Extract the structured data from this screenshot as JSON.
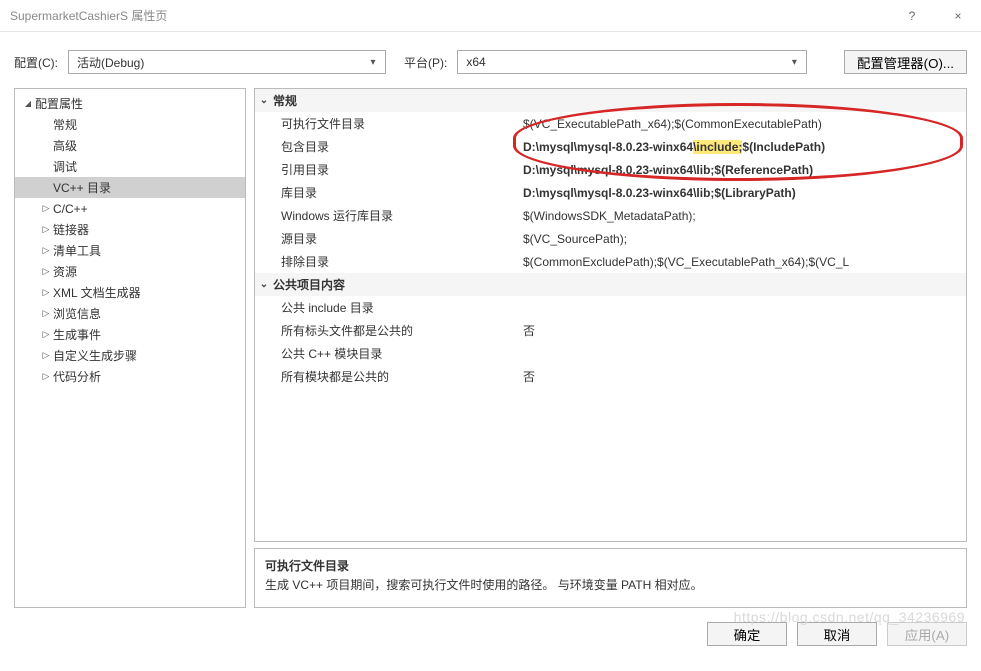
{
  "window": {
    "title": "SupermarketCashierS 属性页",
    "help_icon": "?",
    "close_icon": "×"
  },
  "toolbar": {
    "config_label": "配置(C):",
    "config_value": "活动(Debug)",
    "platform_label": "平台(P):",
    "platform_value": "x64",
    "manager_button": "配置管理器(O)..."
  },
  "tree": [
    {
      "label": "配置属性",
      "depth": 0,
      "expander": "expanded"
    },
    {
      "label": "常规",
      "depth": 1,
      "expander": ""
    },
    {
      "label": "高级",
      "depth": 1,
      "expander": ""
    },
    {
      "label": "调试",
      "depth": 1,
      "expander": ""
    },
    {
      "label": "VC++ 目录",
      "depth": 1,
      "expander": "",
      "selected": true
    },
    {
      "label": "C/C++",
      "depth": 1,
      "expander": "collapsed"
    },
    {
      "label": "链接器",
      "depth": 1,
      "expander": "collapsed"
    },
    {
      "label": "清单工具",
      "depth": 1,
      "expander": "collapsed"
    },
    {
      "label": "资源",
      "depth": 1,
      "expander": "collapsed"
    },
    {
      "label": "XML 文档生成器",
      "depth": 1,
      "expander": "collapsed"
    },
    {
      "label": "浏览信息",
      "depth": 1,
      "expander": "collapsed"
    },
    {
      "label": "生成事件",
      "depth": 1,
      "expander": "collapsed"
    },
    {
      "label": "自定义生成步骤",
      "depth": 1,
      "expander": "collapsed"
    },
    {
      "label": "代码分析",
      "depth": 1,
      "expander": "collapsed"
    }
  ],
  "groups": [
    {
      "title": "常规",
      "rows": [
        {
          "name": "可执行文件目录",
          "value": "$(VC_ExecutablePath_x64);$(CommonExecutablePath)"
        },
        {
          "name": "包含目录",
          "value_prefix": "D:\\mysql\\mysql-8.0.23-winx64",
          "value_hl": "\\include;",
          "value_suffix": "$(IncludePath)",
          "bold": true
        },
        {
          "name": "引用目录",
          "value": "D:\\mysql\\mysql-8.0.23-winx64\\lib;$(ReferencePath)",
          "bold": true
        },
        {
          "name": "库目录",
          "value": "D:\\mysql\\mysql-8.0.23-winx64\\lib;$(LibraryPath)",
          "bold": true
        },
        {
          "name": "Windows 运行库目录",
          "value": "$(WindowsSDK_MetadataPath);"
        },
        {
          "name": "源目录",
          "value": "$(VC_SourcePath);"
        },
        {
          "name": "排除目录",
          "value": "$(CommonExcludePath);$(VC_ExecutablePath_x64);$(VC_L"
        }
      ]
    },
    {
      "title": "公共项目内容",
      "rows": [
        {
          "name": "公共 include 目录",
          "value": ""
        },
        {
          "name": "所有标头文件都是公共的",
          "value": "否"
        },
        {
          "name": "公共 C++ 模块目录",
          "value": ""
        },
        {
          "name": "所有模块都是公共的",
          "value": "否"
        }
      ]
    }
  ],
  "description": {
    "title": "可执行文件目录",
    "body": "生成 VC++ 项目期间，搜索可执行文件时使用的路径。 与环境变量 PATH 相对应。"
  },
  "footer": {
    "ok": "确定",
    "cancel": "取消",
    "apply": "应用(A)"
  },
  "watermark": "https://blog.csdn.net/qq_34236969"
}
